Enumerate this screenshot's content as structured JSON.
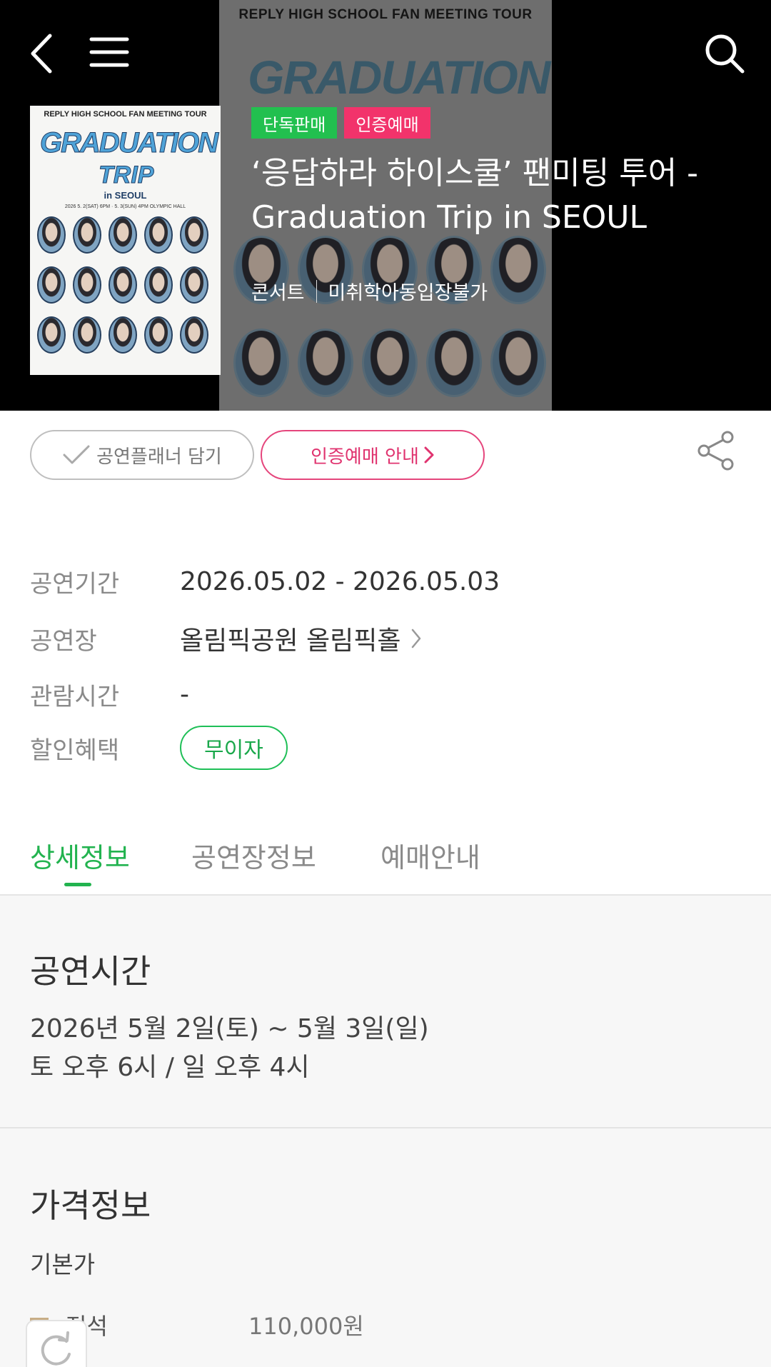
{
  "hero": {
    "poster_header": "REPLY HIGH SCHOOL FAN MEETING TOUR",
    "poster_title_line1": "GRADUATION",
    "poster_title_line2": "TRIP",
    "poster_subtitle": "in SEOUL",
    "poster_info": "2026 5. 2(SAT) 6PM · 5. 3(SUN) 4PM  OLYMPIC HALL",
    "badges": [
      {
        "label": "단독판매",
        "color": "#22c04f"
      },
      {
        "label": "인증예매",
        "color": "#f2336b"
      }
    ],
    "title": "‘응답하라 하이스쿨’ 팬미팅 투어 - Graduation Trip in SEOUL",
    "genre": "콘서트",
    "age_limit": "미취학아동입장불가",
    "icons": [
      "back-arrow-icon",
      "menu-icon",
      "search-icon"
    ]
  },
  "actions": {
    "planner_label": "공연플래너 담기",
    "auth_label": "인증예매 안내",
    "share_icon": "share-icon"
  },
  "info": {
    "period_label": "공연기간",
    "period_value": "2026.05.02 - 2026.05.03",
    "venue_label": "공연장",
    "venue_value": "올림픽공원 올림픽홀",
    "runtime_label": "관람시간",
    "runtime_value": "-",
    "discount_label": "할인혜택",
    "discount_value": "무이자"
  },
  "tabs": [
    {
      "label": "상세정보",
      "active": true
    },
    {
      "label": "공연장정보",
      "active": false
    },
    {
      "label": "예매안내",
      "active": false
    }
  ],
  "detail": {
    "time_title": "공연시간",
    "time_line1": "2026년 5월 2일(토) ~ 5월 3일(일)",
    "time_line2": "토 오후 6시 / 일 오후 4시",
    "price_title": "가격정보",
    "price_sub": "기본가",
    "prices": [
      {
        "seat": "전석",
        "price": "110,000원",
        "color": "#c8ad86"
      }
    ]
  },
  "colors": {
    "accent_green": "#22b34f",
    "accent_pink": "#e0336f"
  }
}
